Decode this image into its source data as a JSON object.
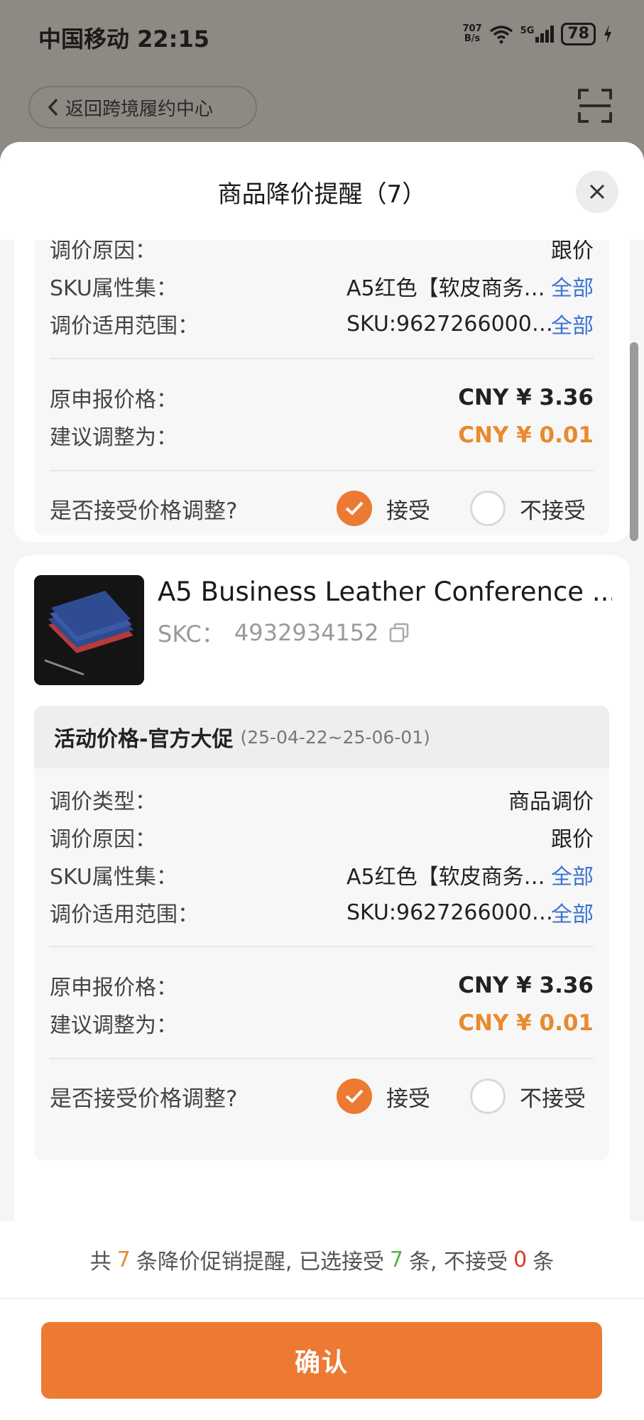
{
  "status_bar": {
    "carrier_time": "中国移动 22:15",
    "net_speed_value": "707",
    "net_speed_unit": "B/s",
    "signal": "5G",
    "battery": "78"
  },
  "background": {
    "back_label": "返回跨境履约中心"
  },
  "modal": {
    "title": "商品降价提醒（7）"
  },
  "card1": {
    "reason_label": "调价原因：",
    "reason_value": "跟价",
    "sku_label": "SKU属性集：",
    "sku_value": "A5红色【软皮商务…",
    "sku_link": "全部",
    "scope_label": "调价适用范围：",
    "scope_value": "SKU:9627266000…",
    "scope_link": "全部",
    "orig_price_label": "原申报价格：",
    "orig_price_value": "CNY ¥ 3.36",
    "suggest_label": "建议调整为：",
    "suggest_value": "CNY ¥ 0.01",
    "question": "是否接受价格调整?",
    "accept": "接受",
    "reject": "不接受"
  },
  "card2": {
    "product_title": "A5 Business Leather Conference ...",
    "skc_label": "SKC：",
    "skc_value": "4932934152",
    "activity": "活动价格-官方大促",
    "activity_dates": "(25-04-22~25-06-01)",
    "type_label": "调价类型：",
    "type_value": "商品调价",
    "reason_label": "调价原因：",
    "reason_value": "跟价",
    "sku_label": "SKU属性集：",
    "sku_value": "A5红色【软皮商务…",
    "sku_link": "全部",
    "scope_label": "调价适用范围：",
    "scope_value": "SKU:9627266000…",
    "scope_link": "全部",
    "orig_price_label": "原申报价格：",
    "orig_price_value": "CNY ¥ 3.36",
    "suggest_label": "建议调整为：",
    "suggest_value": "CNY ¥ 0.01",
    "question": "是否接受价格调整?",
    "accept": "接受",
    "reject": "不接受"
  },
  "summary": {
    "prefix": "共",
    "total": "7",
    "mid1": "条降价促销提醒, 已选接受",
    "accepted": "7",
    "mid2": "条, 不接受",
    "rejected": "0",
    "suffix": "条"
  },
  "confirm_label": "确认",
  "colors": {
    "accent": "#ec7a33",
    "link": "#3b73d0",
    "price_orange": "#e88a2e"
  }
}
